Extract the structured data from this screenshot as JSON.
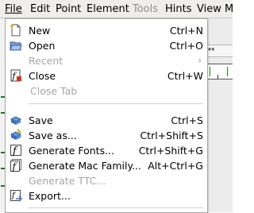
{
  "menubar": {
    "items": [
      {
        "label": "File"
      },
      {
        "label": "Edit"
      },
      {
        "label": "Point"
      },
      {
        "label": "Element"
      },
      {
        "label": "Tools"
      },
      {
        "label": "Hints"
      },
      {
        "label": "View"
      },
      {
        "label": "M"
      }
    ]
  },
  "file_menu": {
    "items": [
      {
        "label": "New",
        "shortcut": "Ctrl+N",
        "icon": "new-document-icon",
        "enabled": true
      },
      {
        "label": "Open",
        "shortcut": "Ctrl+O",
        "icon": "open-folder-icon",
        "enabled": true
      },
      {
        "label": "Recent",
        "shortcut": "",
        "icon": "",
        "enabled": false,
        "submenu": true
      },
      {
        "label": "Close",
        "shortcut": "Ctrl+W",
        "icon": "close-document-icon",
        "enabled": true
      },
      {
        "label": "Close Tab",
        "shortcut": "",
        "icon": "",
        "enabled": false
      },
      {
        "label": "Save",
        "shortcut": "Ctrl+S",
        "icon": "save-icon",
        "enabled": true
      },
      {
        "label": "Save as...",
        "shortcut": "Ctrl+Shift+S",
        "icon": "save-as-icon",
        "enabled": true
      },
      {
        "label": "Generate Fonts...",
        "shortcut": "Ctrl+Shift+G",
        "icon": "generate-fonts-icon",
        "enabled": true
      },
      {
        "label": "Generate Mac Family...",
        "shortcut": "Alt+Ctrl+G",
        "icon": "generate-mac-family-icon",
        "enabled": true
      },
      {
        "label": "Generate TTC...",
        "shortcut": "",
        "icon": "",
        "enabled": false
      },
      {
        "label": "Export...",
        "shortcut": "",
        "icon": "export-icon",
        "enabled": true
      }
    ],
    "submenu_arrow": "›"
  },
  "background": {
    "toolbar_arrows": "↔"
  },
  "colors": {
    "menubar_bg": "#efeeec",
    "menu_bg": "#ffffff",
    "disabled_text": "#a5a5a5",
    "icon_blue": "#3d6fb5",
    "icon_red": "#c0392b"
  }
}
